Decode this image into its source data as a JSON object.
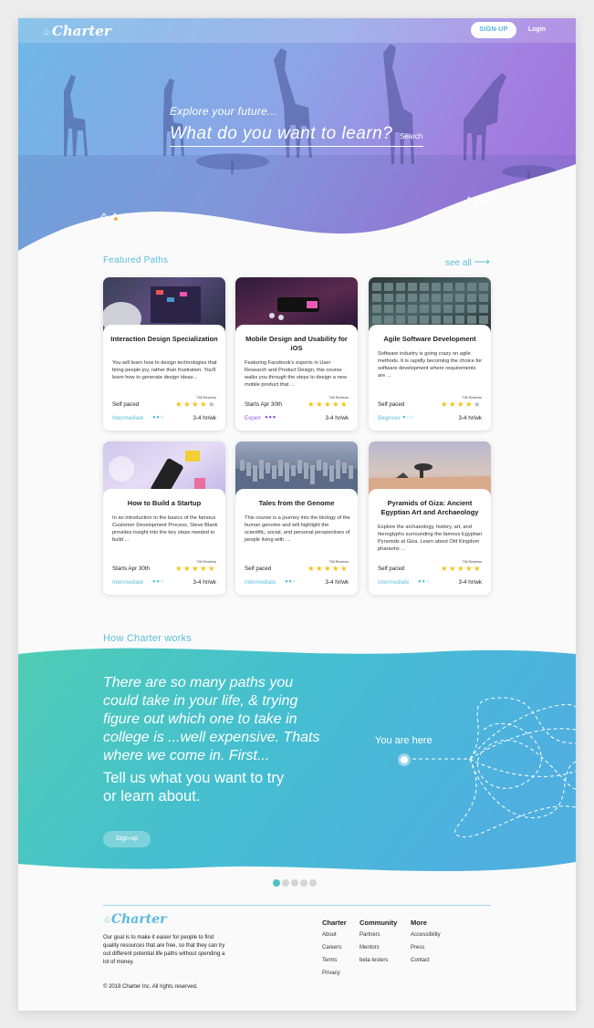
{
  "nav": {
    "logo": "Charter",
    "signup": "SIGN-UP",
    "login": "Login"
  },
  "hero": {
    "explore": "Explore your future...",
    "question": "What do you want to learn?",
    "search": "Search"
  },
  "featured": {
    "heading": "Featured Paths",
    "see_all": "see all"
  },
  "cards": [
    {
      "title": "Interaction Design Specialization",
      "desc": "You will learn how to design technologies that bring people joy, rather than frustration. You'll learn how to generate design ideas...",
      "pace": "Self paced",
      "reviews": "738 Reviews",
      "rating": 4,
      "level": "Intermediate",
      "hours": "3-4 hr/wk",
      "level_color": "#5fbfd7"
    },
    {
      "title": "Mobile Design and Usability for iOS",
      "desc": "Featuring Facebook's experts in User Research and Product Design, this course walks you through the steps to design a new mobile product that ...",
      "pace": "Starts Apr 30th",
      "reviews": "738 Reviews",
      "rating": 5,
      "level": "Expert",
      "hours": "3-4 hr/wk",
      "level_color": "#9b5fe0"
    },
    {
      "title": "Agile Software Development",
      "desc": "Software industry is going crazy on agile methods.  It is rapidly becoming the choice for software development where requirements are ...",
      "pace": "Self paced",
      "reviews": "738 Reviews",
      "rating": 4,
      "level": "Beginner",
      "hours": "3-4 hr/wk",
      "level_color": "#5fbfd7"
    },
    {
      "title": "How to Build a Startup",
      "desc": "In an introduction to the basics of the famous Customer Development Process, Steve Blank provides insight into the key steps needed to build ...",
      "pace": "Starts Apr 30th",
      "reviews": "738 Reviews",
      "rating": 5,
      "level": "Intermediate",
      "hours": "3-4 hr/wk",
      "level_color": "#5fbfd7"
    },
    {
      "title": "Tales from the Genome",
      "desc": "This course is a journey into the biology of the human genome and will highlight the scientific, social, and personal perspectives of people living with ...",
      "pace": "Self paced",
      "reviews": "738 Reviews",
      "rating": 5,
      "level": "Intermediate",
      "hours": "3-4 hr/wk",
      "level_color": "#5fbfd7"
    },
    {
      "title": "Pyramids of Giza: Ancient Egyptian Art and Archaeology",
      "desc": "Explore the archaeology, history, art, and hieroglyphs surrounding the famous Egyptian Pyramids at Giza. Learn about Old Kingdom pharaohs ...",
      "pace": "Self paced",
      "reviews": "738 Reviews",
      "rating": 5,
      "level": "Intermediate",
      "hours": "3-4 hr/wk",
      "level_color": "#5fbfd7"
    }
  ],
  "how": {
    "heading": "How Charter works",
    "quote": "There are so many paths you could take in your life, & trying figure out which one to take in college is ...well expensive. Thats where we come in. First...",
    "tell": "Tell us what you want to try or learn about.",
    "button": "Sign-up",
    "you_are_here": "You are here",
    "pager_active": 1,
    "pager_total": 5
  },
  "footer": {
    "logo": "Charter",
    "desc": "Our goal is to make it easier for people to find quality resources that are free, so that they can try out different potential life paths without spending a lot of money.",
    "copyright": "© 2018 Charter Inc. All rights reserved.",
    "cols": [
      {
        "heading": "Charter",
        "links": [
          "About",
          "Careers",
          "Terms",
          "Privacy"
        ]
      },
      {
        "heading": "Community",
        "links": [
          "Partners",
          "Mentors",
          "beta testers"
        ]
      },
      {
        "heading": "More",
        "links": [
          "Accessibility",
          "Press",
          "Contact"
        ]
      }
    ]
  },
  "colors": {
    "accent": "#5fbfd7",
    "star": "#f0c419",
    "expert": "#9b5fe0"
  }
}
